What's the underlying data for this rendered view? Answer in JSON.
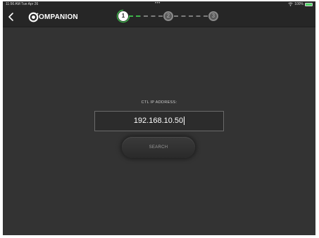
{
  "status_bar": {
    "time_date": "11:56 AM   Tue Apr 26",
    "center_dots": "•••",
    "battery_text": "100%",
    "battery_level": 1.0,
    "icons": [
      "wifi-icon",
      "battery-icon"
    ]
  },
  "nav": {
    "back_icon": "chevron-left-icon",
    "logo_text": "OMPANION"
  },
  "stepper": {
    "steps": [
      "1",
      "2",
      "3"
    ],
    "current_step": 1,
    "active_color": "#3db44a"
  },
  "form": {
    "ip_label": "CTL IP ADDRESS:",
    "ip_value": "192.168.10.50",
    "search_label": "SEARCH"
  },
  "colors": {
    "background": "#333333",
    "navbar": "#262626",
    "accent": "#3db44a"
  }
}
